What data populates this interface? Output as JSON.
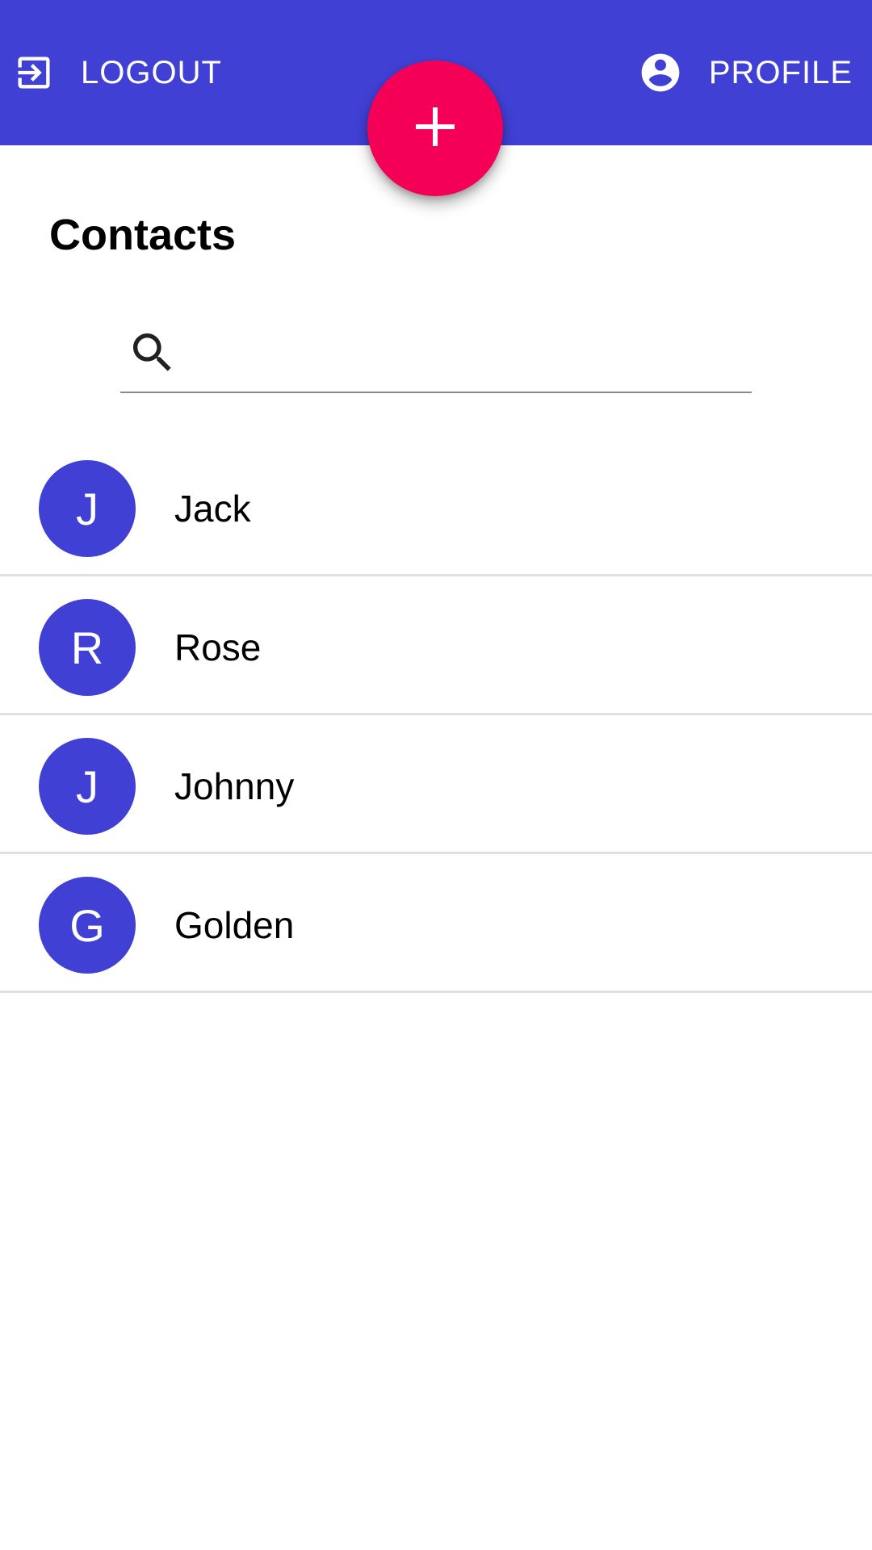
{
  "colors": {
    "primary": "#4040d4",
    "accent": "#f50057",
    "divider": "#e0e0e0"
  },
  "appbar": {
    "logout": {
      "label": "LOGOUT",
      "icon": "exit-to-app-icon"
    },
    "profile": {
      "label": "PROFILE",
      "icon": "account-circle-icon"
    }
  },
  "fab": {
    "icon": "add-icon"
  },
  "page": {
    "title": "Contacts"
  },
  "search": {
    "icon": "search-icon",
    "value": "",
    "placeholder": ""
  },
  "contacts": [
    {
      "initial": "J",
      "name": "Jack"
    },
    {
      "initial": "R",
      "name": "Rose"
    },
    {
      "initial": "J",
      "name": "Johnny"
    },
    {
      "initial": "G",
      "name": "Golden"
    }
  ]
}
